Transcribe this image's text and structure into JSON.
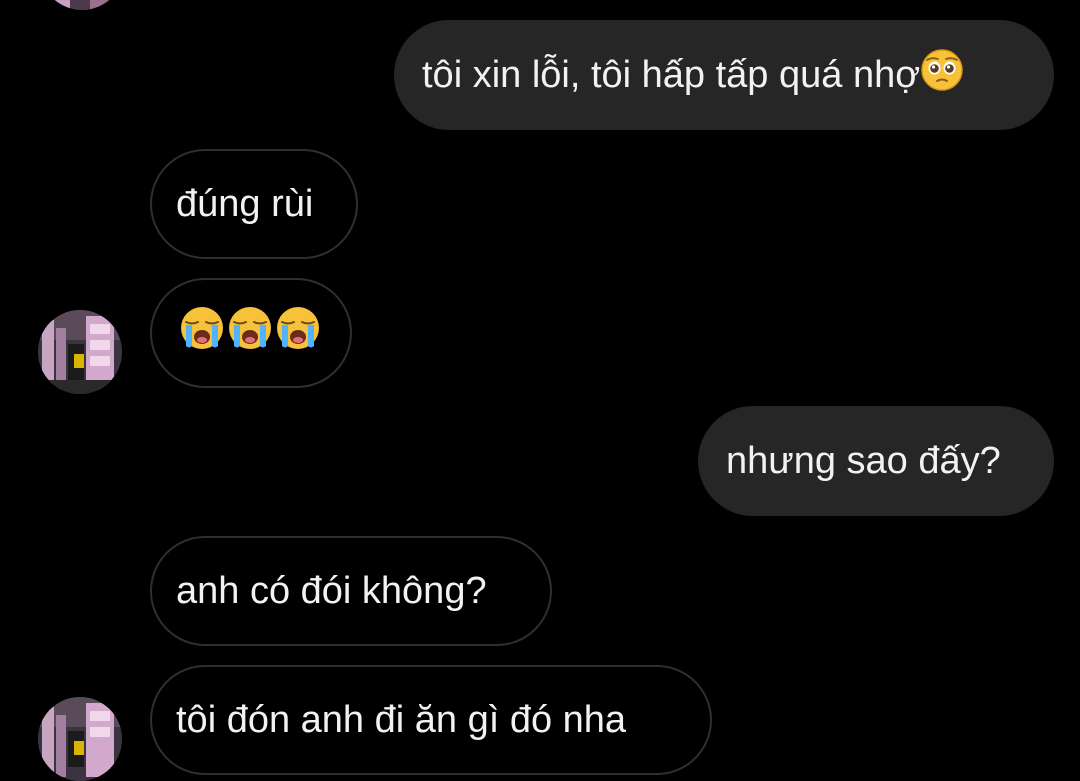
{
  "messages": [
    {
      "from": "me",
      "text": "tôi xin lỗi, tôi hấp tấp quá nhợ",
      "emoji": "pleading-face"
    },
    {
      "from": "them",
      "text": "đúng rùi"
    },
    {
      "from": "them",
      "emoji": [
        "loudly-crying-face",
        "loudly-crying-face",
        "loudly-crying-face"
      ]
    },
    {
      "from": "me",
      "text": "nhưng sao đấy?"
    },
    {
      "from": "them",
      "text": "anh có đói không?"
    },
    {
      "from": "them",
      "text": "tôi đón anh đi ăn gì đó nha"
    }
  ],
  "colors": {
    "background": "#000000",
    "outgoing_bubble": "#262626",
    "incoming_border": "#2f2f2f",
    "text": "#f2f2f2"
  }
}
